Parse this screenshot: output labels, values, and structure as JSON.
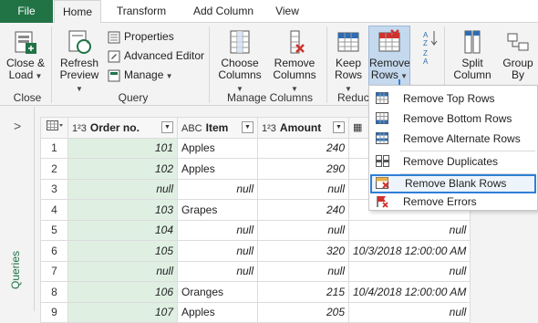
{
  "tabs": {
    "file": "File",
    "home": "Home",
    "transform": "Transform",
    "add_column": "Add Column",
    "view": "View"
  },
  "ribbon": {
    "close_load_1": "Close &",
    "close_load_2": "Load",
    "group_close": "Close",
    "refresh_1": "Refresh",
    "refresh_2": "Preview",
    "properties": "Properties",
    "advanced_editor": "Advanced Editor",
    "manage": "Manage",
    "group_query": "Query",
    "choose_1": "Choose",
    "choose_2": "Columns",
    "remove_cols_1": "Remove",
    "remove_cols_2": "Columns",
    "group_manage": "Manage Columns",
    "keep_1": "Keep",
    "keep_2": "Rows",
    "remove_rows_1": "Remove",
    "remove_rows_2": "Rows",
    "group_reduce": "Reduc",
    "split_1": "Split",
    "split_2": "Column",
    "group_by_1": "Group",
    "group_by_2": "By"
  },
  "sidebar": {
    "label": "Queries"
  },
  "table": {
    "headers": {
      "order": "Order no.",
      "item": "Item",
      "amount": "Amount",
      "type_num": "1²3",
      "type_abc": "ABC"
    },
    "rows": [
      {
        "n": "1",
        "order": "101",
        "item": "Apples",
        "amount": "240",
        "date": ""
      },
      {
        "n": "2",
        "order": "102",
        "item": "Apples",
        "amount": "290",
        "date": ""
      },
      {
        "n": "3",
        "order": "null",
        "item": "null",
        "amount": "null",
        "date": ""
      },
      {
        "n": "4",
        "order": "103",
        "item": "Grapes",
        "amount": "240",
        "date": ""
      },
      {
        "n": "5",
        "order": "104",
        "item": "null",
        "amount": "null",
        "date": "null"
      },
      {
        "n": "6",
        "order": "105",
        "item": "null",
        "amount": "320",
        "date": "10/3/2018 12:00:00 AM"
      },
      {
        "n": "7",
        "order": "null",
        "item": "null",
        "amount": "null",
        "date": "null"
      },
      {
        "n": "8",
        "order": "106",
        "item": "Oranges",
        "amount": "215",
        "date": "10/4/2018 12:00:00 AM"
      },
      {
        "n": "9",
        "order": "107",
        "item": "Apples",
        "amount": "205",
        "date": "null"
      }
    ]
  },
  "menu": {
    "items": [
      "Remove Top Rows",
      "Remove Bottom Rows",
      "Remove Alternate Rows",
      "Remove Duplicates",
      "Remove Blank Rows",
      "Remove Errors"
    ]
  },
  "colors": {
    "accent_green": "#217346",
    "highlight_blue": "#2e7fd6"
  }
}
